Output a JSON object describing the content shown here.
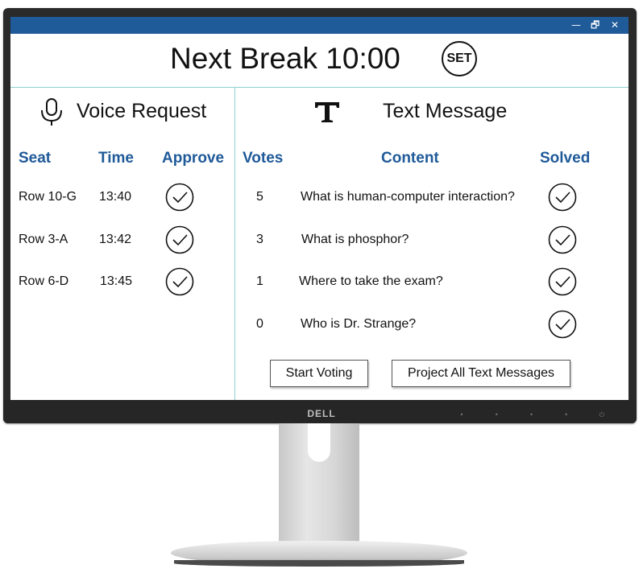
{
  "monitor": {
    "brand": "DELL"
  },
  "window": {
    "controls": {
      "minimize": "—",
      "maximize": "🗗",
      "close": "✕"
    }
  },
  "header": {
    "title": "Next Break 10:00",
    "set_label": "SET"
  },
  "voice": {
    "title": "Voice Request",
    "icon": "microphone-icon",
    "columns": {
      "seat": "Seat",
      "time": "Time",
      "approve": "Approve"
    },
    "rows": [
      {
        "seat": "Row 10-G",
        "time": "13:40"
      },
      {
        "seat": "Row 3-A",
        "time": "13:42"
      },
      {
        "seat": "Row 6-D",
        "time": "13:45"
      }
    ]
  },
  "text": {
    "title": "Text Message",
    "icon": "text-T-icon",
    "columns": {
      "votes": "Votes",
      "content": "Content",
      "solved": "Solved"
    },
    "rows": [
      {
        "votes": "5",
        "content": "What is human-computer interaction?"
      },
      {
        "votes": "3",
        "content": "What is phosphor?"
      },
      {
        "votes": "1",
        "content": "Where to take the exam?"
      },
      {
        "votes": "0",
        "content": "Who is Dr. Strange?"
      }
    ],
    "buttons": {
      "start_voting": "Start Voting",
      "project_all": "Project All Text Messages"
    }
  },
  "colors": {
    "titlebar": "#1f5a99",
    "column_header": "#1f5a99",
    "divider": "#8fd0cf"
  }
}
